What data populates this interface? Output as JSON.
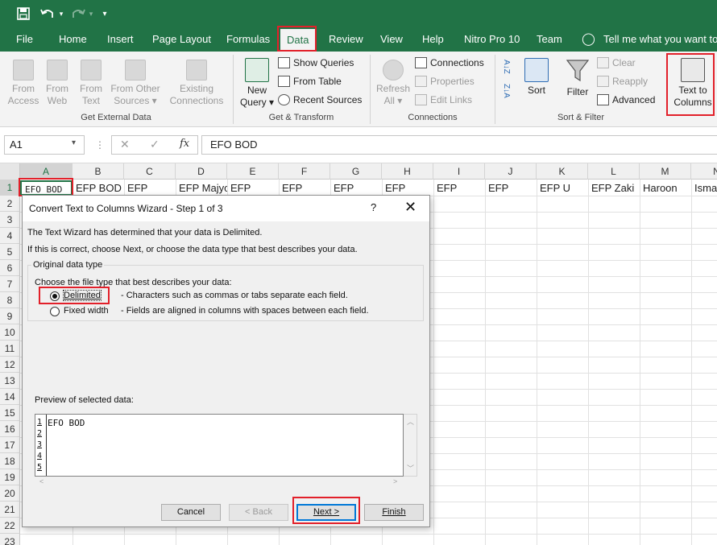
{
  "qat": {
    "save": "save-icon",
    "undo": "undo-icon",
    "redo": "redo-icon",
    "customize": "customize-qat-icon"
  },
  "tabs": [
    "File",
    "Home",
    "Insert",
    "Page Layout",
    "Formulas",
    "Data",
    "Review",
    "View",
    "Help",
    "Nitro Pro 10",
    "Team"
  ],
  "active_tab": "Data",
  "tell_me": "Tell me what you want to d",
  "ribbon": {
    "get_external": {
      "label": "Get External Data",
      "from_access": [
        "From",
        "Access"
      ],
      "from_web": [
        "From",
        "Web"
      ],
      "from_text": [
        "From",
        "Text"
      ],
      "from_other": [
        "From Other",
        "Sources ▾"
      ],
      "existing": [
        "Existing",
        "Connections"
      ]
    },
    "get_transform": {
      "label": "Get & Transform",
      "new_query": [
        "New",
        "Query ▾"
      ],
      "show_queries": "Show Queries",
      "from_table": "From Table",
      "recent_sources": "Recent Sources"
    },
    "connections": {
      "label": "Connections",
      "refresh_all": [
        "Refresh",
        "All ▾"
      ],
      "connections": "Connections",
      "properties": "Properties",
      "edit_links": "Edit Links"
    },
    "sort_filter": {
      "label": "Sort & Filter",
      "sort": "Sort",
      "filter": "Filter",
      "clear": "Clear",
      "reapply": "Reapply",
      "advanced": "Advanced",
      "az": "A↓Z",
      "za": "Z↓A"
    },
    "data_tools": {
      "text_to_columns": [
        "Text to",
        "Columns"
      ]
    }
  },
  "formula_bar": {
    "name_box": "A1",
    "cancel": "✕",
    "enter": "✓",
    "fx": "fx",
    "value": "EFO BOD"
  },
  "grid": {
    "columns": [
      "A",
      "B",
      "C",
      "D",
      "E",
      "F",
      "G",
      "H",
      "I",
      "J",
      "K",
      "L",
      "M",
      "N"
    ],
    "rows": [
      "1",
      "2",
      "3",
      "4",
      "5",
      "6",
      "7",
      "8",
      "9",
      "10",
      "11",
      "12",
      "13",
      "14",
      "15",
      "16",
      "17",
      "18",
      "19",
      "20",
      "21",
      "22",
      "23"
    ],
    "row1": [
      "EFO  BOD",
      "EFP BOD S",
      "EFP",
      "EFP Majyo",
      "EFP",
      "EFP",
      "EFP",
      "EFP",
      "EFP",
      "EFP",
      "EFP U",
      "EFP Zaki",
      "Haroon",
      "Isma"
    ]
  },
  "dialog": {
    "title": "Convert Text to Columns Wizard - Step 1 of 3",
    "help": "?",
    "close": "✕",
    "line1": "The Text Wizard has determined that your data is Delimited.",
    "line2": "If this is correct, choose Next, or choose the data type that best describes your data.",
    "group_label": "Original data type",
    "choose_label": "Choose the file type that best describes your data:",
    "options": [
      {
        "label": "Delimited",
        "desc": "- Characters such as commas or tabs separate each field.",
        "selected": true
      },
      {
        "label": "Fixed width",
        "desc": "- Fields are aligned in columns with spaces between each field.",
        "selected": false
      }
    ],
    "preview_label": "Preview of selected data:",
    "preview_rows": [
      "1",
      "2",
      "3",
      "4",
      "5"
    ],
    "preview_line1": "EFO BOD",
    "buttons": {
      "cancel": "Cancel",
      "back": "< Back",
      "next": "Next >",
      "finish": "Finish"
    }
  }
}
